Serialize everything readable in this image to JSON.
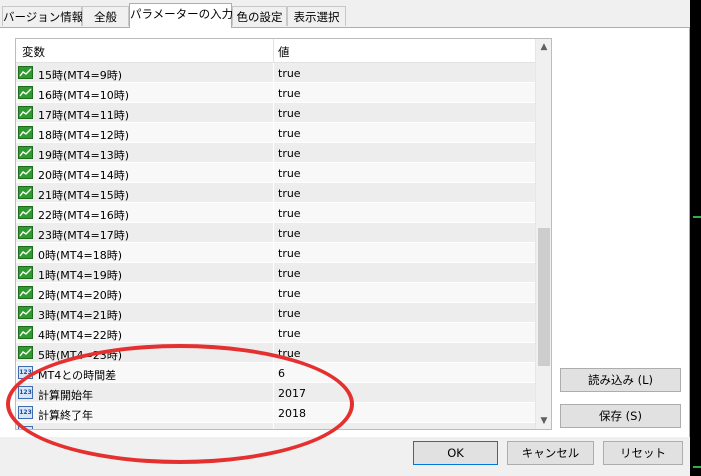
{
  "tabs": [
    {
      "label": "バージョン情報",
      "active": false
    },
    {
      "label": "全般",
      "active": false
    },
    {
      "label": "パラメーターの入力",
      "active": true
    },
    {
      "label": "色の設定",
      "active": false
    },
    {
      "label": "表示選択",
      "active": false
    }
  ],
  "grid": {
    "col_variable": "変数",
    "col_value": "値",
    "rows": [
      {
        "icon": "bool-param-icon",
        "name": "15時(MT4=9時)",
        "value": "true"
      },
      {
        "icon": "bool-param-icon",
        "name": "16時(MT4=10時)",
        "value": "true"
      },
      {
        "icon": "bool-param-icon",
        "name": "17時(MT4=11時)",
        "value": "true"
      },
      {
        "icon": "bool-param-icon",
        "name": "18時(MT4=12時)",
        "value": "true"
      },
      {
        "icon": "bool-param-icon",
        "name": "19時(MT4=13時)",
        "value": "true"
      },
      {
        "icon": "bool-param-icon",
        "name": "20時(MT4=14時)",
        "value": "true"
      },
      {
        "icon": "bool-param-icon",
        "name": "21時(MT4=15時)",
        "value": "true"
      },
      {
        "icon": "bool-param-icon",
        "name": "22時(MT4=16時)",
        "value": "true"
      },
      {
        "icon": "bool-param-icon",
        "name": "23時(MT4=17時)",
        "value": "true"
      },
      {
        "icon": "bool-param-icon",
        "name": "0時(MT4=18時)",
        "value": "true"
      },
      {
        "icon": "bool-param-icon",
        "name": "1時(MT4=19時)",
        "value": "true"
      },
      {
        "icon": "bool-param-icon",
        "name": "2時(MT4=20時)",
        "value": "true"
      },
      {
        "icon": "bool-param-icon",
        "name": "3時(MT4=21時)",
        "value": "true"
      },
      {
        "icon": "bool-param-icon",
        "name": "4時(MT4=22時)",
        "value": "true"
      },
      {
        "icon": "bool-param-icon",
        "name": "5時(MT4=23時)",
        "value": "true"
      },
      {
        "icon": "int-param-icon",
        "name": "MT4との時間差",
        "value": "6"
      },
      {
        "icon": "int-param-icon",
        "name": "計算開始年",
        "value": "2017"
      },
      {
        "icon": "int-param-icon",
        "name": "計算終了年",
        "value": "2018"
      },
      {
        "icon": "int-param-icon",
        "name": "",
        "value": ""
      }
    ]
  },
  "buttons": {
    "load": "読み込み (L)",
    "save": "保存 (S)",
    "ok": "OK",
    "cancel": "キャンセル",
    "reset": "リセット"
  },
  "icons": {
    "scroll_up": "▲",
    "scroll_down": "▼",
    "num_glyph": "123"
  },
  "colors": {
    "highlight_circle": "#e53030",
    "bool_icon": "#2f9a2f",
    "chart_marker": "#27b34a"
  }
}
